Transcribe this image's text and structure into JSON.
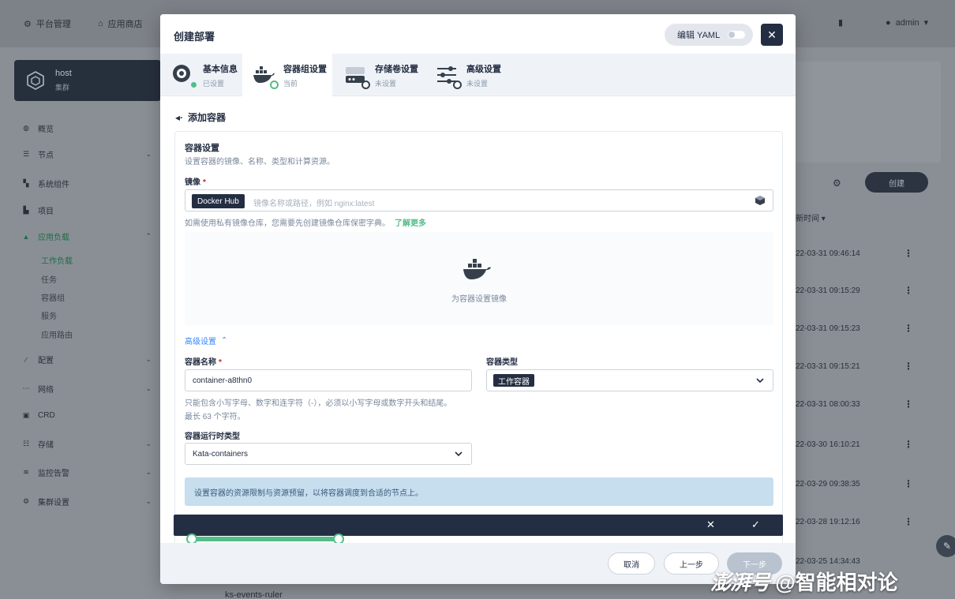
{
  "topbar": {
    "platform": "平台管理",
    "appstore": "应用商店",
    "user": "admin"
  },
  "cluster": {
    "name": "host",
    "sub": "集群"
  },
  "nav": [
    {
      "label": "概览"
    },
    {
      "label": "节点"
    },
    {
      "label": "系统组件"
    },
    {
      "label": "项目"
    },
    {
      "label": "应用负载"
    },
    {
      "label": "配置"
    },
    {
      "label": "网络"
    },
    {
      "label": "CRD"
    },
    {
      "label": "存储"
    },
    {
      "label": "监控告警"
    },
    {
      "label": "集群设置"
    }
  ],
  "nav_sub": [
    "工作负载",
    "任务",
    "容器组",
    "服务",
    "应用路由"
  ],
  "background": {
    "create_label": "创建",
    "col_header": "新时间",
    "rows": [
      "22-03-31 09:46:14",
      "22-03-31 09:15:29",
      "22-03-31 09:15:23",
      "22-03-31 09:15:21",
      "22-03-31 08:00:33",
      "22-03-30 16:10:21",
      "22-03-29 09:38:35",
      "22-03-28 19:12:16",
      "22-03-25 14:34:43"
    ],
    "bottom_cut": "ks-events-ruler"
  },
  "modal": {
    "title": "创建部署",
    "yaml_label": "编辑 YAML",
    "close_glyph": "✕",
    "tabs": [
      {
        "label": "基本信息",
        "status": "已设置"
      },
      {
        "label": "容器组设置",
        "status": "当前"
      },
      {
        "label": "存储卷设置",
        "status": "未设置"
      },
      {
        "label": "高级设置",
        "status": "未设置"
      }
    ],
    "back_label": "添加容器",
    "section_title": "容器设置",
    "section_desc": "设置容器的镜像、名称、类型和计算资源。",
    "image_label": "镜像",
    "image_registry": "Docker Hub",
    "image_placeholder": "镜像名称或路径，例如 nginx:latest",
    "image_hint": "如需使用私有镜像仓库，您需要先创建镜像仓库保密字典。",
    "image_hint_link": "了解更多",
    "empty_text": "为容器设置镜像",
    "advanced_label": "高级设置",
    "name_label": "容器名称",
    "name_value": "container-a8thn0",
    "name_hint_1": "只能包含小写字母、数字和连字符（-），必须以小写字母或数字开头和结尾。",
    "name_hint_2": "最长 63 个字符。",
    "type_label": "容器类型",
    "type_value": "工作容器",
    "runtime_label": "容器运行时类型",
    "runtime_value": "Kata-containers",
    "info_text": "设置容器的资源限制与资源预留，以将容器调度到合适的节点上。",
    "action_cancel_glyph": "✕",
    "action_ok_glyph": "✓",
    "footer": {
      "cancel": "取消",
      "prev": "上一步",
      "next": "下一步"
    }
  },
  "watermark": {
    "logo": "澎湃号",
    "account": "@智能相对论"
  }
}
